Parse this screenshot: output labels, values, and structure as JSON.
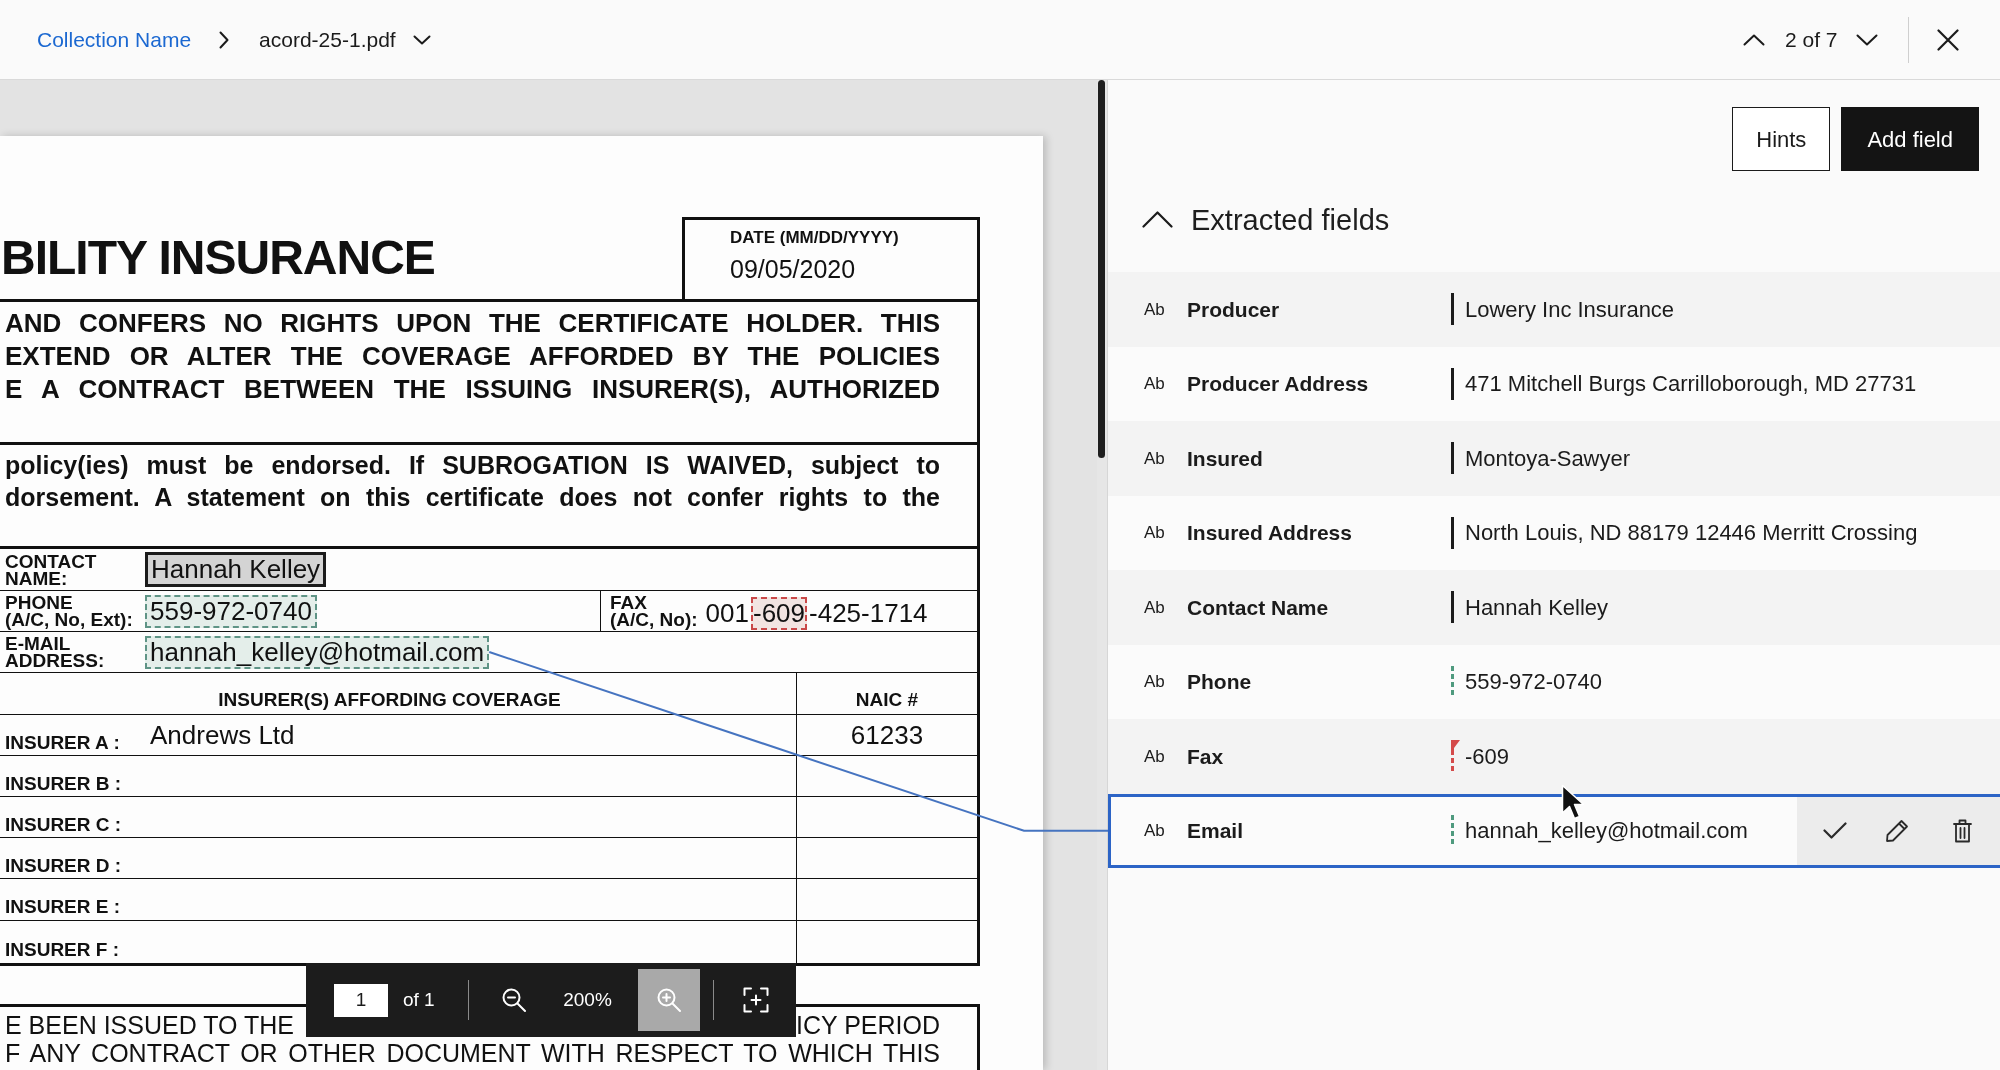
{
  "top_bar": {
    "collection_link": "Collection Name",
    "file_name": "acord-25-1.pdf",
    "pager": "2 of 7"
  },
  "document": {
    "title": "BILITY INSURANCE",
    "date_label": "DATE (MM/DD/YYYY)",
    "date_value": "09/05/2020",
    "notice_lines": [
      "AND CONFERS NO RIGHTS UPON THE CERTIFICATE HOLDER. THIS",
      "EXTEND OR ALTER THE COVERAGE AFFORDED BY THE POLICIES",
      "E A CONTRACT BETWEEN THE ISSUING INSURER(S), AUTHORIZED"
    ],
    "subrogation_lines": [
      "policy(ies) must be endorsed. If SUBROGATION IS WAIVED, subject to",
      "dorsement. A statement on this certificate does not confer rights to the"
    ],
    "contact_rows": [
      {
        "label_lines": [
          "CONTACT",
          "NAME:"
        ],
        "value": "Hannah Kelley",
        "confirmed": true,
        "linked": false
      },
      {
        "label_lines": [
          "PHONE",
          "(A/C, No, Ext):"
        ],
        "value": "559-972-0740",
        "confirmed": false,
        "linked": false,
        "fax": {
          "label_lines": [
            "FAX",
            "(A/C, No):"
          ],
          "value_parts": [
            {
              "text": "001",
              "flagged": false
            },
            {
              "text": "-609",
              "flagged": true
            },
            {
              "text": "-425-1714",
              "flagged": false
            }
          ]
        }
      },
      {
        "label_lines": [
          "E-MAIL",
          "ADDRESS:"
        ],
        "value": "hannah_kelley@hotmail.com",
        "confirmed": false,
        "linked": true
      }
    ],
    "insurer_table": {
      "columns": [
        "INSURER(S) AFFORDING COVERAGE",
        "NAIC #"
      ],
      "rows": [
        {
          "label": "INSURER A :",
          "insurer": "Andrews Ltd",
          "naic": "61233"
        },
        {
          "label": "INSURER B :"
        },
        {
          "label": "INSURER C :"
        },
        {
          "label": "INSURER D :"
        },
        {
          "label": "INSURER E :"
        },
        {
          "label": "INSURER F :"
        }
      ]
    },
    "certification": {
      "line_1_left": "E BEEN ISSUED TO THE",
      "line_1_right": "ICY PERIOD",
      "line_2": "F ANY CONTRACT OR OTHER DOCUMENT WITH RESPECT TO WHICH THIS"
    }
  },
  "toolbar": {
    "page": "1",
    "page_count": "of 1",
    "zoom_out": {
      "active": false
    },
    "zoom": "200%",
    "zoom_in": {
      "active": true
    },
    "fit": {
      "active": false
    }
  },
  "panel": {
    "buttons": [
      {
        "label": "Hints",
        "kind": "outline"
      },
      {
        "label": "Add field",
        "kind": "primary"
      }
    ],
    "section": {
      "title": "Extracted fields",
      "expanded": true
    },
    "fields": [
      {
        "type": "Ab",
        "name": "Producer",
        "value": "Lowery Inc Insurance",
        "confirmed": true,
        "flagged": false,
        "selected": false
      },
      {
        "type": "Ab",
        "name": "Producer Address",
        "value": "471 Mitchell Burgs Carrilloborough, MD 27731",
        "confirmed": true,
        "flagged": false,
        "selected": false
      },
      {
        "type": "Ab",
        "name": "Insured",
        "value": "Montoya-Sawyer",
        "confirmed": true,
        "flagged": false,
        "selected": false
      },
      {
        "type": "Ab",
        "name": "Insured Address",
        "value": "North Louis, ND 88179 12446 Merritt Crossing",
        "confirmed": true,
        "flagged": false,
        "selected": false
      },
      {
        "type": "Ab",
        "name": "Contact Name",
        "value": "Hannah Kelley",
        "confirmed": true,
        "flagged": false,
        "selected": false
      },
      {
        "type": "Ab",
        "name": "Phone",
        "value": "559-972-0740",
        "confirmed": false,
        "flagged": false,
        "selected": false
      },
      {
        "type": "Ab",
        "name": "Fax",
        "value": "-609",
        "confirmed": false,
        "flagged": true,
        "selected": false
      },
      {
        "type": "Ab",
        "name": "Email",
        "value": "hannah_kelley@hotmail.com",
        "confirmed": false,
        "flagged": false,
        "selected": true
      }
    ]
  }
}
